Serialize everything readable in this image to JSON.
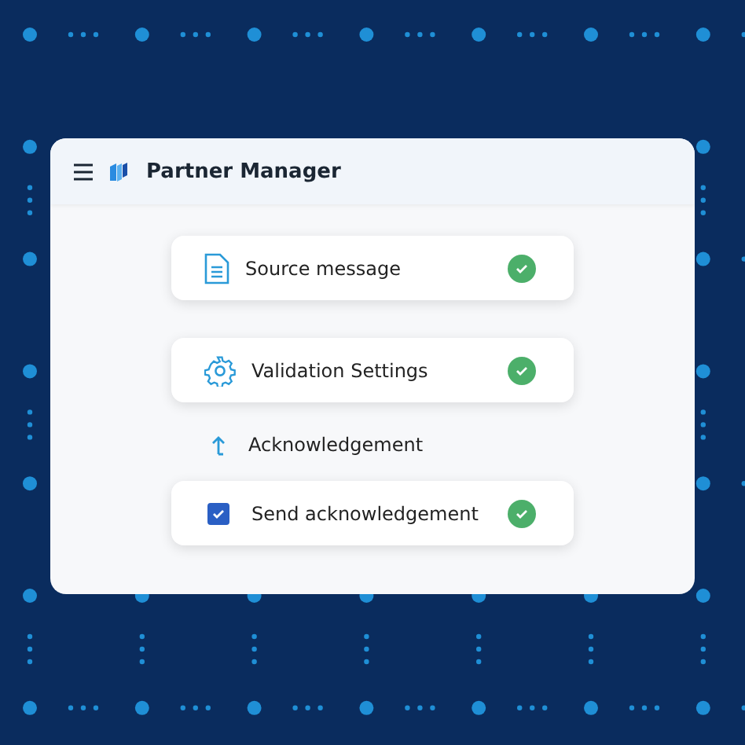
{
  "window": {
    "title": "Partner Manager"
  },
  "steps": [
    {
      "kind": "document",
      "label": "Source message",
      "done": true
    },
    {
      "kind": "settings",
      "label": "Validation Settings",
      "done": true
    },
    {
      "kind": "section",
      "label": "Acknowledgement"
    },
    {
      "kind": "checkbox",
      "label": "Send acknowledgement",
      "checked": true,
      "done": true
    }
  ]
}
